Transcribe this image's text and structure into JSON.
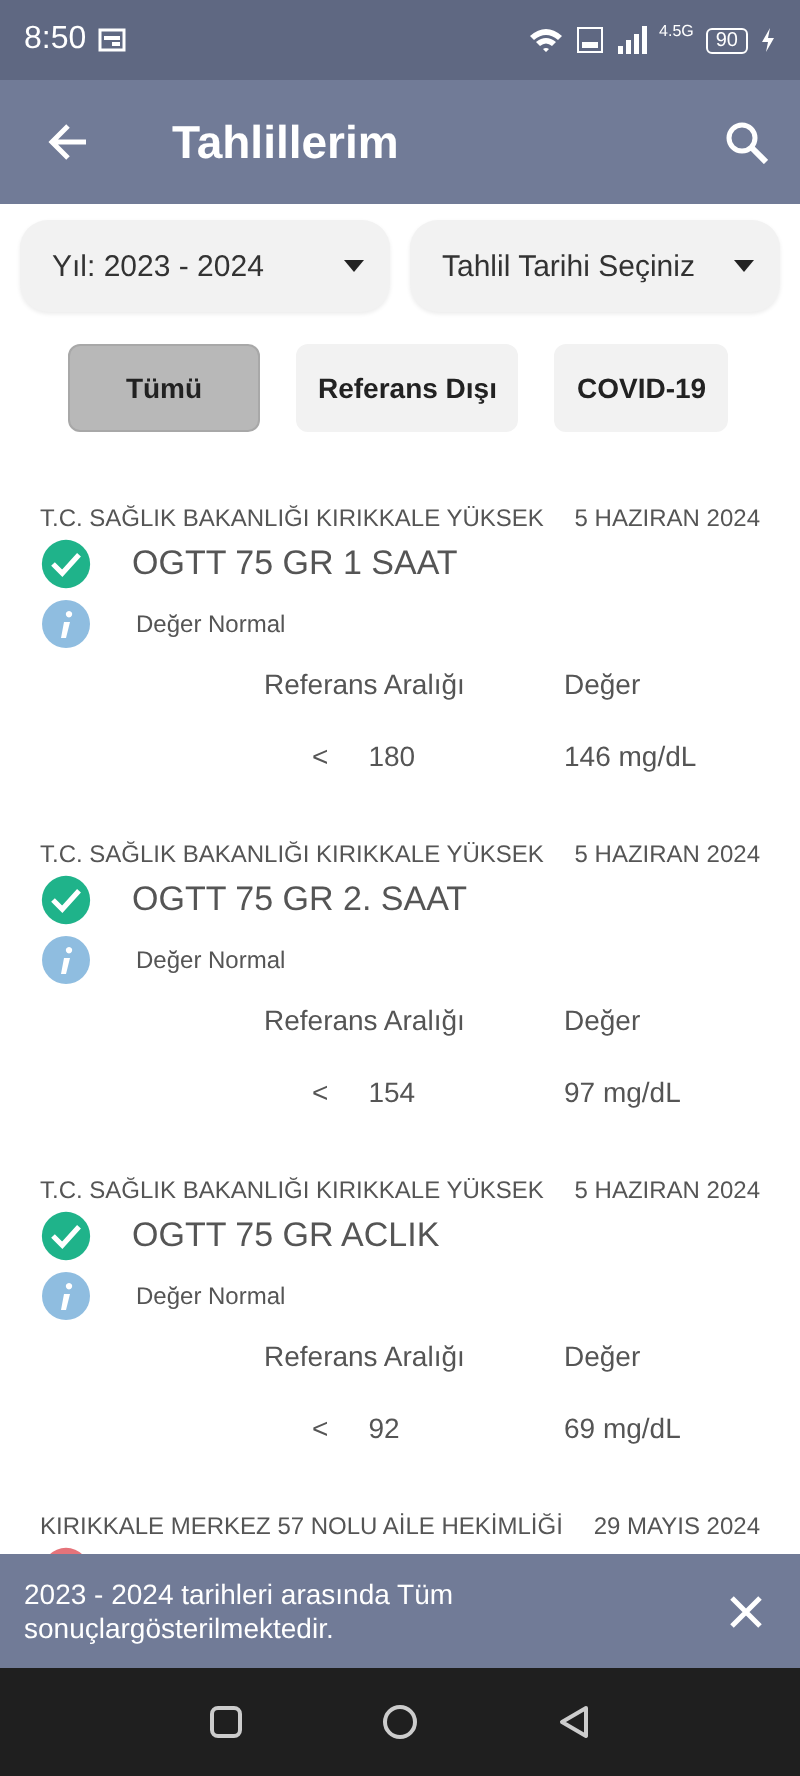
{
  "status_bar": {
    "time": "8:50",
    "network": "4.5G",
    "battery": "90"
  },
  "app_bar": {
    "title": "Tahlillerim"
  },
  "filters": [
    {
      "label": "Yıl: 2023 - 2024"
    },
    {
      "label": "Tahlil Tarihi Seçiniz"
    }
  ],
  "chips": [
    {
      "label": "Tümü",
      "selected": true
    },
    {
      "label": "Referans Dışı",
      "selected": false
    },
    {
      "label": "COVID-19",
      "selected": false
    }
  ],
  "results": [
    {
      "institution": "T.C. SAĞLIK BAKANLIĞI KIRIKKALE YÜKSEK",
      "date": "5 HAZIRAN 2024",
      "kind": "normal",
      "test": "OGTT 75 GR 1 SAAT",
      "note": "Değer Normal",
      "ref_header": "Referans Aralığı",
      "value_header": "Değer",
      "operator": "<",
      "ref": "180",
      "value": "146 mg/dL"
    },
    {
      "institution": "T.C. SAĞLIK BAKANLIĞI KIRIKKALE YÜKSEK",
      "date": "5 HAZIRAN 2024",
      "kind": "normal",
      "test": "OGTT 75 GR 2. SAAT",
      "note": "Değer Normal",
      "ref_header": "Referans Aralığı",
      "value_header": "Değer",
      "operator": "<",
      "ref": "154",
      "value": "97 mg/dL"
    },
    {
      "institution": "T.C. SAĞLIK BAKANLIĞI KIRIKKALE YÜKSEK",
      "date": "5 HAZIRAN 2024",
      "kind": "normal",
      "test": "OGTT 75 GR ACLIK",
      "note": "Değer Normal",
      "ref_header": "Referans Aralığı",
      "value_header": "Değer",
      "operator": "<",
      "ref": "92",
      "value": "69 mg/dL"
    },
    {
      "institution": "KIRIKKALE MERKEZ 57 NOLU AİLE HEKİMLİĞİ",
      "date": "29 MAYIS 2024",
      "kind": "abnormal"
    }
  ],
  "snackbar": {
    "message": "2023 - 2024 tarihleri arasında Tüm sonuçlargösterilmektedir."
  }
}
